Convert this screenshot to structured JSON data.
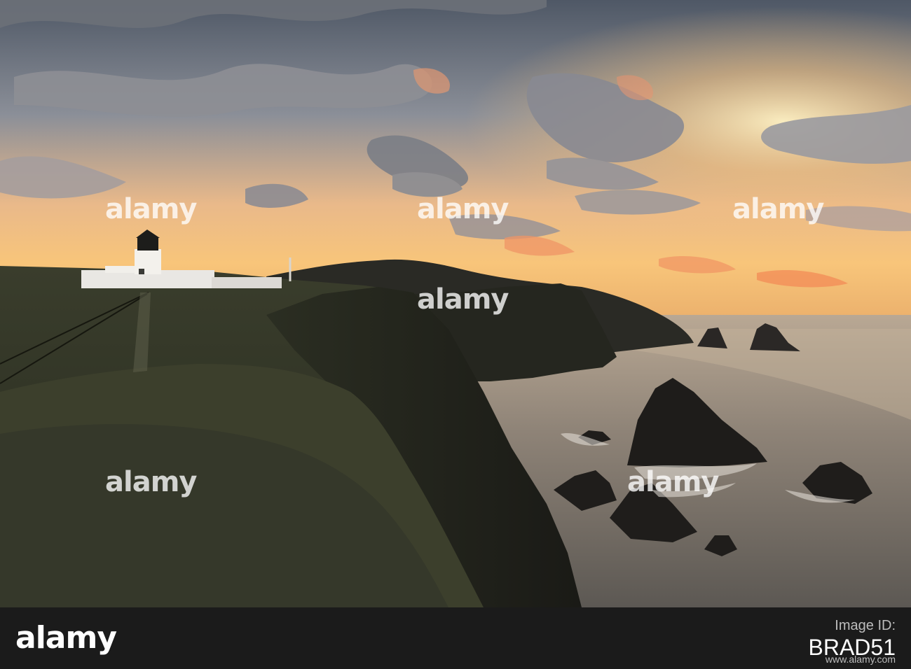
{
  "watermark": {
    "text": "alamy"
  },
  "footer": {
    "logo": "alamy",
    "image_id_label": "Image ID:",
    "image_id": "BRAD51",
    "url": "www.alamy.com"
  },
  "colors": {
    "sky_top": "#5f6876",
    "sky_glow": "#f7b768",
    "sea": "#8f8a82",
    "cliff": "#1f201b",
    "footer_bg": "#1b1b1b"
  }
}
